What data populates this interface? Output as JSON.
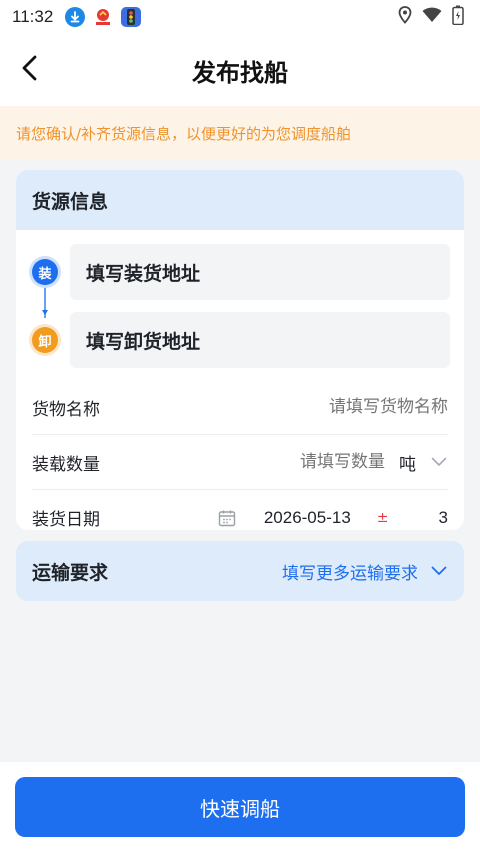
{
  "status_bar": {
    "time": "11:32",
    "icons": [
      "download-icon",
      "party-badge-icon",
      "traffic-light-icon"
    ],
    "right_icons": [
      "location-icon",
      "wifi-icon",
      "battery-icon"
    ]
  },
  "nav": {
    "title": "发布找船",
    "back_icon": "chevron-left-icon"
  },
  "notice": {
    "text": "请您确认/补齐货源信息，以便更好的为您调度船舶"
  },
  "goods": {
    "title": "货源信息",
    "load": {
      "badge": "装",
      "placeholder": "填写装货地址"
    },
    "unload": {
      "badge": "卸",
      "placeholder": "填写卸货地址"
    },
    "name": {
      "label": "货物名称",
      "placeholder": "请填写货物名称"
    },
    "quantity": {
      "label": "装载数量",
      "placeholder": "请填写数量",
      "unit": "吨"
    },
    "date": {
      "label": "装货日期",
      "value": "2026-05-13",
      "plus_minus": "±",
      "range": "3"
    }
  },
  "transport": {
    "title": "运输要求",
    "link": "填写更多运输要求"
  },
  "submit": {
    "label": "快速调船"
  },
  "colors": {
    "primary": "#1e6ff0",
    "notice_text": "#f0932b",
    "notice_bg": "#fdf3e6",
    "header_bg": "#deebfb",
    "unload_badge": "#f29c1f"
  }
}
